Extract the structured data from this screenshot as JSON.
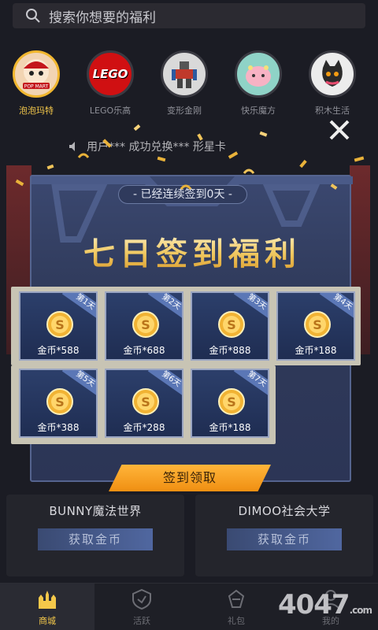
{
  "search": {
    "placeholder": "搜索你想要的福利"
  },
  "brands": [
    {
      "name": "泡泡玛特",
      "logo_text": "POP MART",
      "active": true
    },
    {
      "name": "LEGO乐高",
      "logo_text": "LEGO",
      "active": false
    },
    {
      "name": "变形金刚",
      "logo_text": "",
      "active": false
    },
    {
      "name": "快乐魔方",
      "logo_text": "",
      "active": false
    },
    {
      "name": "积木生活",
      "logo_text": "",
      "active": false
    }
  ],
  "notice": {
    "text": "用户*** 成功兑换*** 形星卡"
  },
  "modal": {
    "streak_text": "- 已经连续签到0天 -",
    "title": "七日签到福利",
    "days": [
      {
        "label": "第1天",
        "reward": "金币*588"
      },
      {
        "label": "第2天",
        "reward": "金币*688"
      },
      {
        "label": "第3天",
        "reward": "金币*888"
      },
      {
        "label": "第4天",
        "reward": "金币*188"
      },
      {
        "label": "第5天",
        "reward": "金币*388"
      },
      {
        "label": "第6天",
        "reward": "金币*288"
      },
      {
        "label": "第7天",
        "reward": "金币*188"
      }
    ],
    "claim_label": "签到领取"
  },
  "cards": [
    {
      "title": "BUNNY魔法世界",
      "button": "获取金币"
    },
    {
      "title": "DIMOO社会大学",
      "button": "获取金币"
    }
  ],
  "nav": [
    {
      "label": "商城",
      "icon": "castle-icon",
      "active": true
    },
    {
      "label": "活跃",
      "icon": "shield-icon",
      "active": false
    },
    {
      "label": "礼包",
      "icon": "gift-icon",
      "active": false
    },
    {
      "label": "我的",
      "icon": "user-icon",
      "active": false
    }
  ],
  "watermark": {
    "text": "4047",
    "suffix": ".com"
  },
  "colors": {
    "gold": "#f4c84a",
    "modal_bg": "#3b4870",
    "button": "#f5a623"
  }
}
